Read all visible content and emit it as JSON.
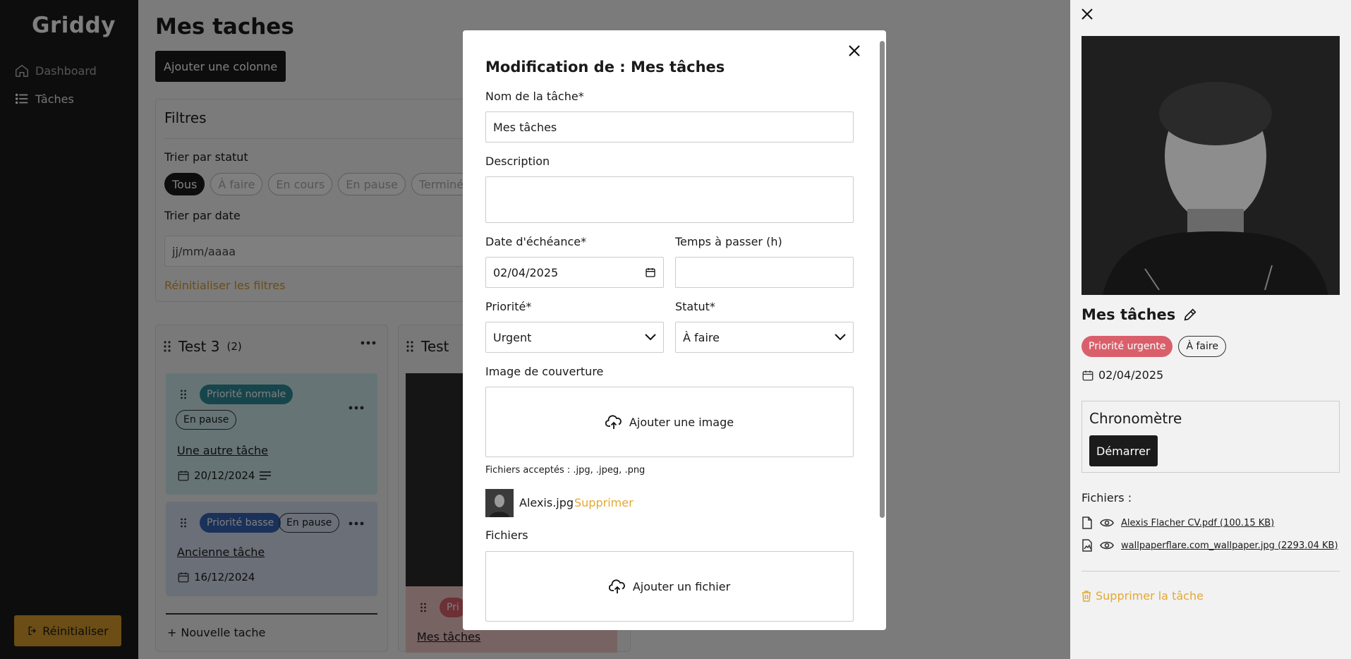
{
  "app": {
    "logo": "Griddy"
  },
  "sidebar": {
    "items": [
      {
        "label": "Dashboard",
        "icon": "home-icon"
      },
      {
        "label": "Tâches",
        "icon": "list-icon"
      }
    ],
    "reset_label": "Réinitialiser"
  },
  "main": {
    "title": "Mes taches",
    "add_column_label": "Ajouter une colonne",
    "filters": {
      "title": "Filtres",
      "status_label": "Trier par statut",
      "status_options": [
        "Tous",
        "À faire",
        "En cours",
        "En pause",
        "Terminé"
      ],
      "active_status": "Tous",
      "date_label": "Trier par date",
      "date_placeholder": "jj/mm/aaaa",
      "reset_label": "Réinitialiser les filtres"
    },
    "columns": [
      {
        "name": "Test 3",
        "count": "(2)",
        "cards": [
          {
            "priority": "Priorité normale",
            "priority_color": "#2f8a98",
            "status": "En pause",
            "title": "Une autre tâche",
            "date": "20/12/2024"
          },
          {
            "priority": "Priorité basse",
            "priority_color": "#3563b5",
            "status": "En pause",
            "title": "Ancienne tâche",
            "date": "16/12/2024"
          }
        ],
        "new_task_label": "Nouvelle tache"
      },
      {
        "name": "Test",
        "card_priority_fragment": "Pri",
        "card_title": "Mes tâches"
      }
    ]
  },
  "modal": {
    "title": "Modification de : Mes tâches",
    "name_label": "Nom de la tâche*",
    "name_value": "Mes tâches",
    "description_label": "Description",
    "description_value": "",
    "due_label": "Date d'échéance*",
    "due_value": "02/04/2025",
    "time_label": "Temps à passer (h)",
    "time_value": "",
    "priority_label": "Priorité*",
    "priority_value": "Urgent",
    "status_label": "Statut*",
    "status_value": "À faire",
    "cover_label": "Image de couverture",
    "add_image_label": "Ajouter une image",
    "accepted_files": "Fichiers acceptés : .jpg, .jpeg, .png",
    "image_file": "Alexis.jpg",
    "delete_label": "Supprimer",
    "files_label": "Fichiers",
    "add_file_label": "Ajouter un fichier"
  },
  "panel": {
    "task_title": "Mes tâches",
    "priority_badge": "Priorité urgente",
    "priority_color": "#d9606b",
    "status_badge": "À faire",
    "date": "02/04/2025",
    "chrono_title": "Chronomètre",
    "chrono_button": "Démarrer",
    "files_label": "Fichiers :",
    "files": [
      {
        "name": "Alexis Flacher CV.pdf (100.15 KB)",
        "icon": "file-icon"
      },
      {
        "name": "wallpaperflare.com_wallpaper.jpg (2293.04 KB)",
        "icon": "image-file-icon"
      }
    ],
    "delete_task_label": "Supprimer la tâche"
  }
}
